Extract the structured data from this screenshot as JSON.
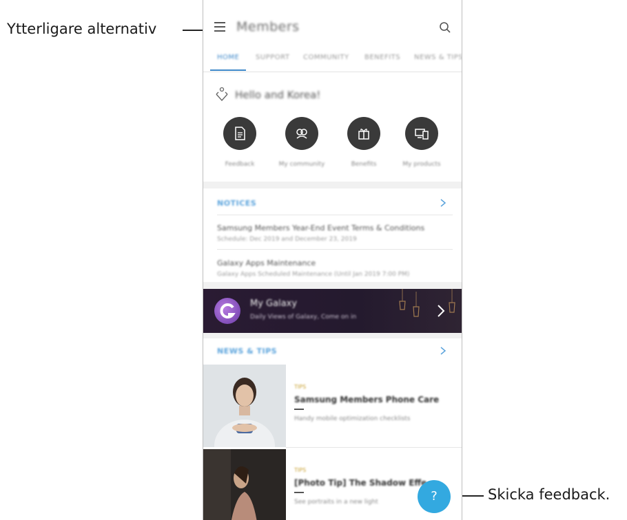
{
  "callouts": {
    "more_options": "Ytterligare alternativ",
    "send_feedback": "Skicka feedback."
  },
  "app": {
    "title": "Members",
    "menu_icon": "hamburger-icon",
    "search_icon": "search-icon"
  },
  "tabs": [
    "HOME",
    "SUPPORT",
    "COMMUNITY",
    "BENEFITS",
    "NEWS & TIPS"
  ],
  "active_tab": "HOME",
  "greeting": "Hello and Korea!",
  "quick_actions": [
    {
      "label": "Feedback",
      "icon": "document-icon"
    },
    {
      "label": "My community",
      "icon": "people-icon"
    },
    {
      "label": "Benefits",
      "icon": "gift-icon"
    },
    {
      "label": "My products",
      "icon": "devices-icon"
    }
  ],
  "notices": {
    "header": "NOTICES",
    "items": [
      {
        "title": "Samsung Members Year-End Event Terms & Conditions",
        "subtitle": "Schedule: Dec 2019 and December 23, 2019"
      },
      {
        "title": "Galaxy Apps Maintenance",
        "subtitle": "Galaxy Apps Scheduled Maintenance (Until Jan 2019 7:00 PM)"
      }
    ]
  },
  "galaxy_banner": {
    "title": "My Galaxy",
    "subtitle": "Daily Views of Galaxy, Come on in"
  },
  "news": {
    "header": "NEWS & TIPS",
    "items": [
      {
        "meta": "TIPS",
        "title": "Samsung Members Phone Care",
        "subtitle": "Handy mobile optimization checklists"
      },
      {
        "meta": "TIPS",
        "title": "[Photo Tip] The Shadow Effe",
        "subtitle": "See portraits in a new light"
      }
    ]
  },
  "fab": {
    "label": "?",
    "icon": "help-icon"
  },
  "colors": {
    "accent": "#3e88c9",
    "fab": "#33a9e0",
    "banner": "#2a1b33"
  }
}
